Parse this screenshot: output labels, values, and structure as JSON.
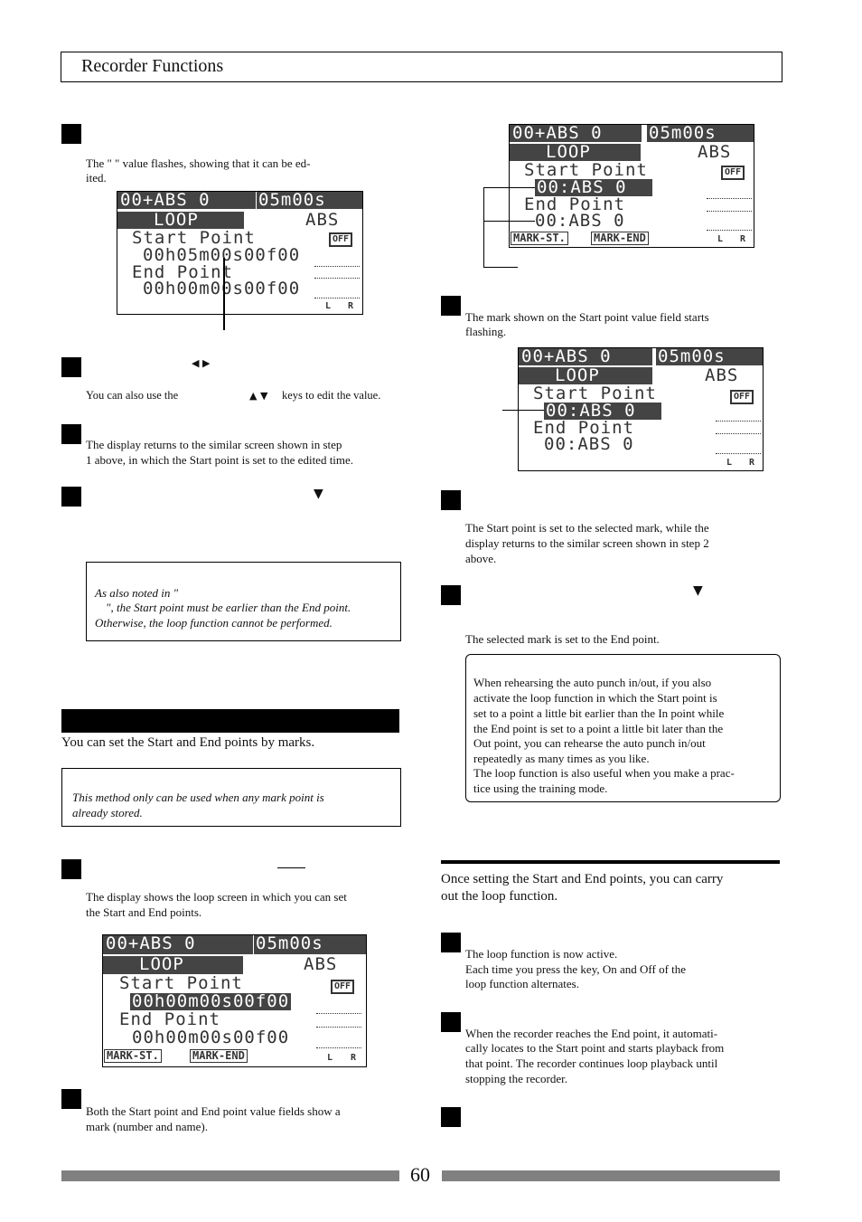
{
  "header": {
    "title": "Recorder Functions"
  },
  "left": {
    "step_a_text": "The \"            \" value flashes, showing that it can be ed-",
    "step_a_text2": "ited.",
    "step_b_arrows": "◀ ▶",
    "step_b_note_pre": "You can also use the",
    "step_b_note_arrows": "▲ ▼",
    "step_b_note_post": "keys to edit the value.",
    "step_c_text1": "The display returns to the similar screen shown in step",
    "step_c_text2": "1 above, in which the Start point is set to the edited time.",
    "step_d_arrow": "▼",
    "note1_line1": "As also noted in \"",
    "note1_line2": "\", the Start point must be earlier than the End point.",
    "note1_line3": "Otherwise, the loop function cannot be performed.",
    "section_intro": "You can set the Start and End points by marks.",
    "note2_line1": "This method only can be used when any mark point is",
    "note2_line2": "already stored.",
    "step1_text1": "The display shows the loop screen in which you can set",
    "step1_text2": "the Start and End points.",
    "step2_text1": "Both the Start point and End point value fields show a",
    "step2_text2": "mark (number and name)."
  },
  "right": {
    "step3_text1": "The mark shown on the Start point value field starts",
    "step3_text2": "flashing.",
    "step4_text1": "The Start point is set to the selected mark, while the",
    "step4_text2": "display returns to the similar screen shown in step 2",
    "step4_text3": "above.",
    "step5_arrow": "▼",
    "step5_text": "The selected mark is set to the End point.",
    "tip_lines": [
      "When rehearsing the auto punch in/out, if you also",
      "activate the loop function in which the Start point is",
      "set to a point a little bit earlier than the In point while",
      "the End point is set to a point a little bit later than the",
      "Out point, you can rehearse the auto punch in/out",
      "repeatedly as many times as you like.",
      "The loop function is also useful when you make a prac-",
      "tice using the training mode."
    ],
    "section2_intro1": "Once setting the Start and End points, you can carry",
    "section2_intro2": "out the loop function.",
    "run1_text1": "The loop function is now active.",
    "run1_text2": "Each time you press the            key, On and Off of the",
    "run1_text3": "loop function alternates.",
    "run2_text1": "When the recorder reaches the End point, it automati-",
    "run2_text2": "cally locates to the Start point and starts playback from",
    "run2_text3": "that point. The recorder continues loop playback until",
    "run2_text4": "stopping the recorder."
  },
  "lcd1": {
    "top_left": "00+ABS 0",
    "top_right": "05m00s",
    "mode": "LOOP",
    "scale": "ABS",
    "start_label": "Start Point",
    "start_value": "00h05m00s00f00",
    "end_label": "End Point",
    "end_value": "00h00m00s00f00",
    "off": "OFF",
    "l": "L",
    "r": "R"
  },
  "lcd2": {
    "top_left": "00+ABS 0",
    "top_right": "05m00s",
    "mode": "LOOP",
    "scale": "ABS",
    "start_label": "Start Point",
    "start_value": "00h00m00s00f00",
    "end_label": "End Point",
    "end_value": "00h00m00s00f00",
    "off": "OFF",
    "tab1": "MARK-ST.",
    "tab2": "MARK-END",
    "l": "L",
    "r": "R"
  },
  "lcd3": {
    "top_left": "00+ABS 0",
    "top_right": "05m00s",
    "mode": "LOOP",
    "scale": "ABS",
    "start_label": "Start Point",
    "start_value": "00:ABS 0",
    "end_label": "End Point",
    "end_value": "00:ABS 0",
    "off": "OFF",
    "tab1": "MARK-ST.",
    "tab2": "MARK-END",
    "l": "L",
    "r": "R"
  },
  "lcd4": {
    "top_left": "00+ABS 0",
    "top_right": "05m00s",
    "mode": "LOOP",
    "scale": "ABS",
    "start_label": "Start Point",
    "start_value": "00:ABS 0",
    "end_label": "End Point",
    "end_value": "00:ABS 0",
    "off": "OFF",
    "l": "L",
    "r": "R"
  },
  "footer": {
    "page_number": "60"
  }
}
